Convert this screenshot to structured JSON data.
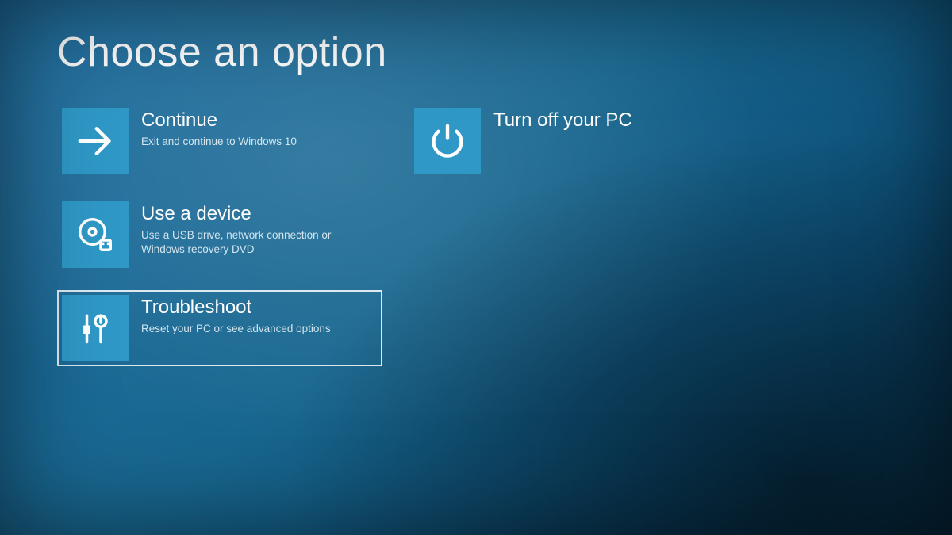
{
  "title": "Choose an option",
  "tiles": {
    "continue": {
      "title": "Continue",
      "desc": "Exit and continue to Windows 10"
    },
    "device": {
      "title": "Use a device",
      "desc": "Use a USB drive, network connection or Windows recovery DVD"
    },
    "trouble": {
      "title": "Troubleshoot",
      "desc": "Reset your PC or see advanced options"
    },
    "poweroff": {
      "title": "Turn off your PC",
      "desc": ""
    }
  },
  "selected": "trouble"
}
